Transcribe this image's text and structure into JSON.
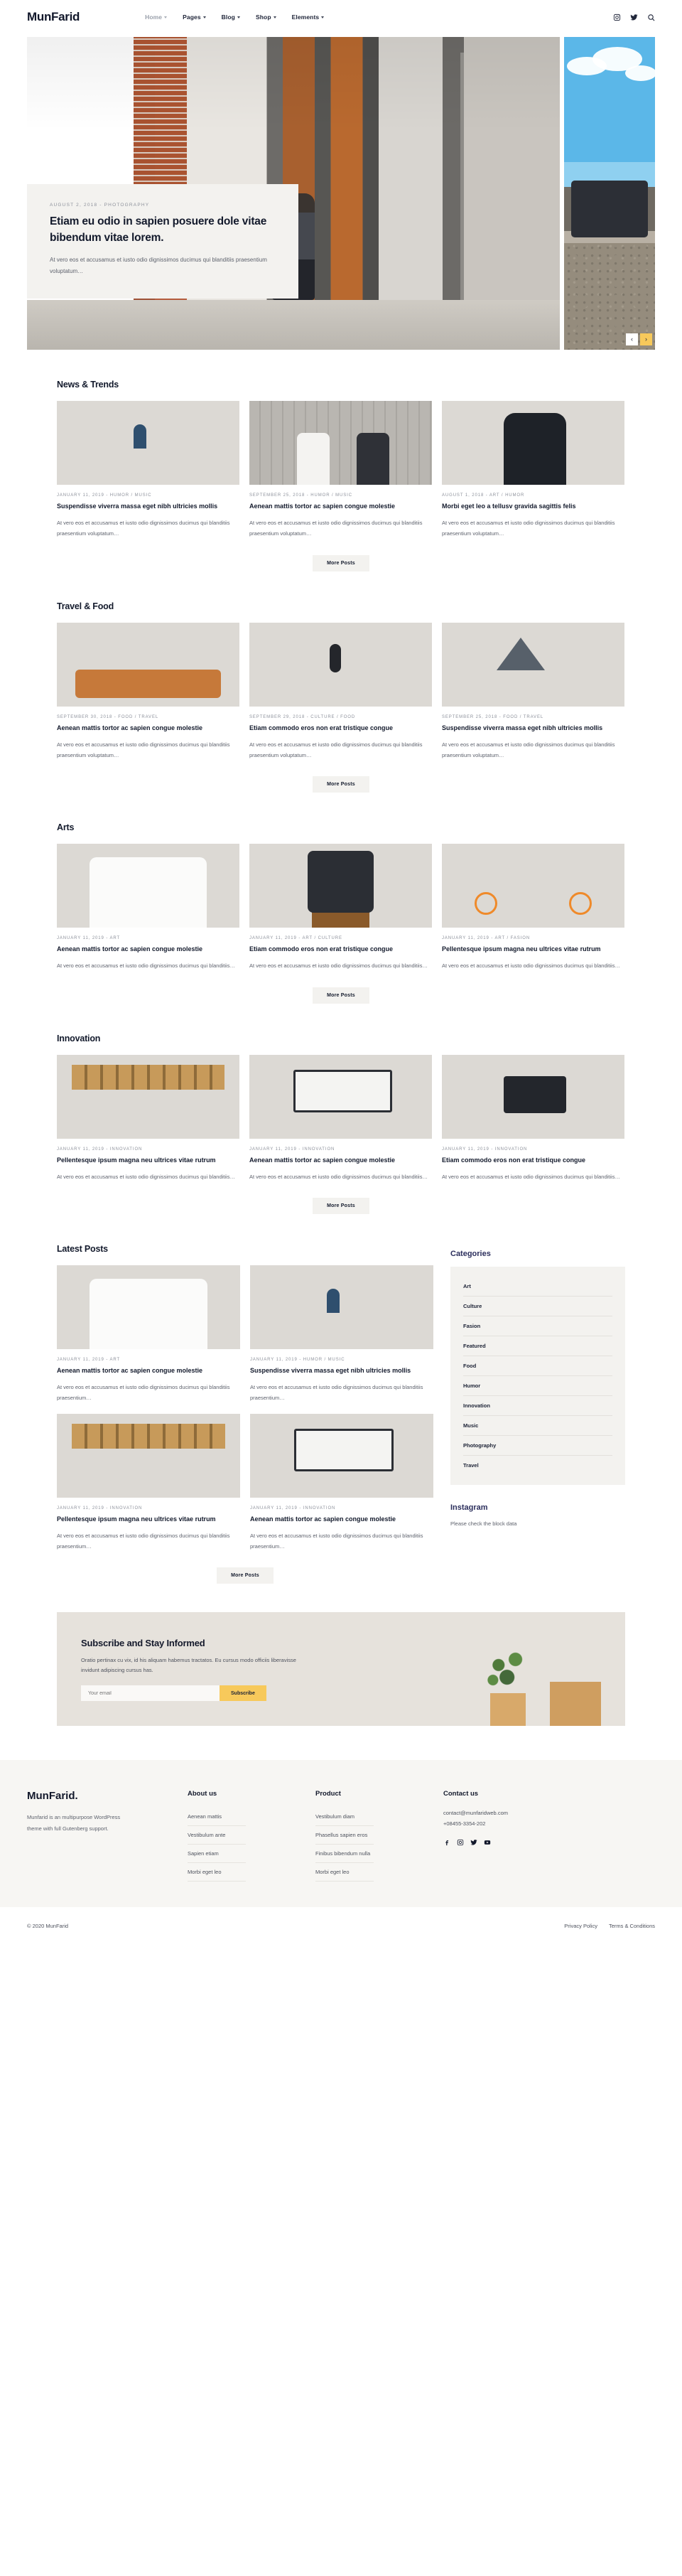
{
  "header": {
    "brand": "MunFarid",
    "nav": [
      {
        "label": "Home",
        "caret": true,
        "active": true
      },
      {
        "label": "Pages",
        "caret": true,
        "active": false
      },
      {
        "label": "Blog",
        "caret": true,
        "active": false
      },
      {
        "label": "Shop",
        "caret": true,
        "active": false
      },
      {
        "label": "Elements",
        "caret": true,
        "active": false
      }
    ],
    "icons": [
      "instagram-icon",
      "twitter-icon",
      "search-icon"
    ]
  },
  "hero": {
    "meta": "AUGUST 2, 2018  -  PHOTOGRAPHY",
    "title": "Etiam eu odio in sapien posuere dole vitae bibendum vitae lorem.",
    "excerpt": "At vero eos et accusamus et iusto odio dignissimos ducimus qui blanditiis praesentium voluptatum…",
    "prev_label": "‹",
    "next_label": "›"
  },
  "sections": [
    {
      "title": "News & Trends",
      "more_label": "More Posts",
      "cards": [
        {
          "meta": "JANUARY 11, 2019 - HUMOR /  MUSIC",
          "title": "Suspendisse viverra massa eget nibh ultricies mollis",
          "excerpt": "At vero eos et accusamus et iusto odio dignissimos ducimus qui blanditiis praesentium voluptatum…",
          "thumb": "t-venice"
        },
        {
          "meta": "SEPTEMBER 25, 2018 - HUMOR /  MUSIC",
          "title": "Aenean mattis tortor ac sapien congue molestie",
          "excerpt": "At vero eos et accusamus et iusto odio dignissimos ducimus qui blanditiis praesentium voluptatum…",
          "thumb": "t-couple"
        },
        {
          "meta": "AUGUST 1, 2018 - ART /  HUMOR",
          "title": "Morbi eget leo a tellusv gravida sagittis felis",
          "excerpt": "At vero eos et accusamus et iusto odio dignissimos ducimus qui blanditiis praesentium voluptatum…",
          "thumb": "t-girl"
        }
      ]
    },
    {
      "title": "Travel & Food",
      "more_label": "More Posts",
      "cards": [
        {
          "meta": "SEPTEMBER 30, 2018 - FOOD /  TRAVEL",
          "title": "Aenean mattis tortor ac sapien congue molestie",
          "excerpt": "At vero eos et accusamus et iusto odio dignissimos ducimus qui blanditiis praesentium voluptatum…",
          "thumb": "t-picnic"
        },
        {
          "meta": "SEPTEMBER 29, 2018 - CULTURE /  FOOD",
          "title": "Etiam commodo eros non erat tristique congue",
          "excerpt": "At vero eos et accusamus et iusto odio dignissimos ducimus qui blanditiis praesentium voluptatum…",
          "thumb": "t-skate"
        },
        {
          "meta": "SEPTEMBER 25, 2018 - FOOD /  TRAVEL",
          "title": "Suspendisse viverra massa eget nibh ultricies mollis",
          "excerpt": "At vero eos et accusamus et iusto odio dignissimos ducimus qui blanditiis praesentium voluptatum…",
          "thumb": "t-mountain"
        }
      ]
    },
    {
      "title": "Arts",
      "more_label": "More Posts",
      "cards": [
        {
          "meta": "JANUARY 11, 2019 - ART",
          "title": "Aenean mattis tortor ac sapien congue molestie",
          "excerpt": "At vero eos et accusamus et iusto odio dignissimos ducimus qui blanditiis…",
          "thumb": "t-yellow"
        },
        {
          "meta": "JANUARY 11, 2019 - ART /  CULTURE",
          "title": "Etiam commodo eros non erat tristique congue",
          "excerpt": "At vero eos et accusamus et iusto odio dignissimos ducimus qui blanditiis…",
          "thumb": "t-boots"
        },
        {
          "meta": "JANUARY 11, 2019 - ART /  FASION",
          "title": "Pellentesque ipsum magna neu ultrices vitae rutrum",
          "excerpt": "At vero eos et accusamus et iusto odio dignissimos ducimus qui blanditiis…",
          "thumb": "t-bike"
        }
      ]
    },
    {
      "title": "Innovation",
      "more_label": "More Posts",
      "cards": [
        {
          "meta": "JANUARY 11, 2019 - INNOVATION",
          "title": "Pellentesque ipsum magna neu ultrices vitae rutrum",
          "excerpt": "At vero eos et accusamus et iusto odio dignissimos ducimus qui blanditiis…",
          "thumb": "t-office"
        },
        {
          "meta": "JANUARY 11, 2019 - INNOVATION",
          "title": "Aenean mattis tortor ac sapien congue molestie",
          "excerpt": "At vero eos et accusamus et iusto odio dignissimos ducimus qui blanditiis…",
          "thumb": "t-laptop"
        },
        {
          "meta": "JANUARY 11, 2019 - INNOVATION",
          "title": "Etiam commodo eros non erat tristique congue",
          "excerpt": "At vero eos et accusamus et iusto odio dignissimos ducimus qui blanditiis…",
          "thumb": "t-camera"
        }
      ]
    }
  ],
  "latest": {
    "title": "Latest Posts",
    "more_label": "More Posts",
    "cards": [
      {
        "meta": "JANUARY 11, 2019 - ART",
        "title": "Aenean mattis tortor ac sapien congue molestie",
        "excerpt": "At vero eos et accusamus et iusto odio dignissimos ducimus qui blanditiis praesentium…",
        "thumb": "t-yellow"
      },
      {
        "meta": "JANUARY 11, 2019 - HUMOR /  MUSIC",
        "title": "Suspendisse viverra massa eget nibh ultricies mollis",
        "excerpt": "At vero eos et accusamus et iusto odio dignissimos ducimus qui blanditiis praesentium…",
        "thumb": "t-venice"
      },
      {
        "meta": "JANUARY 11, 2019 - INNOVATION",
        "title": "Pellentesque ipsum magna neu ultrices vitae rutrum",
        "excerpt": "At vero eos et accusamus et iusto odio dignissimos ducimus qui blanditiis praesentium…",
        "thumb": "t-office"
      },
      {
        "meta": "JANUARY 11, 2019 - INNOVATION",
        "title": "Aenean mattis tortor ac sapien congue molestie",
        "excerpt": "At vero eos et accusamus et iusto odio dignissimos ducimus qui blanditiis praesentium…",
        "thumb": "t-laptop"
      }
    ]
  },
  "sidebar": {
    "categories_title": "Categories",
    "categories": [
      "Art",
      "Culture",
      "Fasion",
      "Featured",
      "Food",
      "Humor",
      "Innovation",
      "Music",
      "Photography",
      "Travel"
    ],
    "instagram_title": "Instagram",
    "instagram_note": "Please check the block data"
  },
  "subscribe": {
    "title": "Subscribe and Stay Informed",
    "text": "Oratio pertinax cu vix, id his aliquam habemus tractatos. Eu cursus modo officiis liberavisse invidunt adipiscing cursus has.",
    "placeholder": "Your email",
    "button": "Subscribe"
  },
  "footer": {
    "brand": "MunFarid.",
    "brand_text": "Munfarid is an multipurpose WordPress theme with full Gutenberg support.",
    "columns": [
      {
        "title": "About us",
        "links": [
          "Aenean mattis",
          "Vestibulum ante",
          "Sapien etiam",
          "Morbi eget leo"
        ]
      },
      {
        "title": "Product",
        "links": [
          "Vestibulum diam",
          "Phasellus sapien eros",
          "Finibus bibendum nulla",
          "Morbi eget leo"
        ]
      }
    ],
    "contact_title": "Contact us",
    "email": "contact@munfaridweb.com",
    "phone": "+08455-3354-202",
    "social": [
      "facebook-icon",
      "instagram-icon",
      "twitter-icon",
      "youtube-icon"
    ],
    "copyright": "© 2020 MunFarid",
    "bottom_links": [
      "Privacy Policy",
      "Terms & Conditions"
    ]
  },
  "colors": {
    "accent": "#f7c95b",
    "dark": "#131a2c",
    "muted": "#8d919b",
    "panel": "#f3f2ef"
  }
}
